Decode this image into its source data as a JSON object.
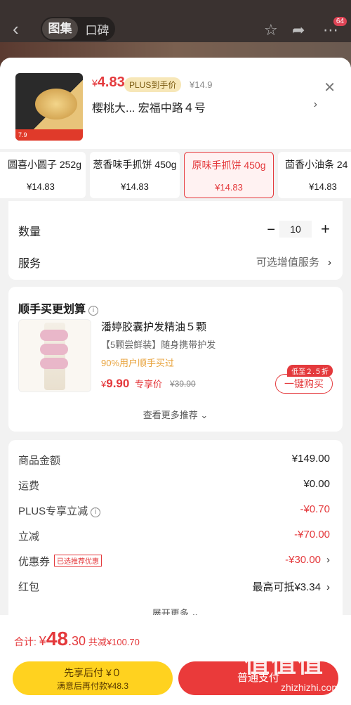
{
  "topbar": {
    "seg_tabs": [
      "图集",
      "口碑"
    ],
    "badge": "64"
  },
  "product": {
    "price_symbol": "¥",
    "price": "4.83",
    "plus_tag": "PLUS到手价",
    "orig_price": "¥14.9",
    "address": "樱桃大...  宏福中路４号",
    "thumb_tag": "7.9"
  },
  "variants": [
    {
      "name": "圆喜小圆子 252g",
      "price": "¥14.83"
    },
    {
      "name": "葱香味手抓饼 450g",
      "price": "¥14.83"
    },
    {
      "name": "原味手抓饼 450g",
      "price": "¥14.83"
    },
    {
      "name": "茴香小油条 24",
      "price": "¥14.83"
    }
  ],
  "quantity": {
    "label": "数量",
    "value": "10",
    "minus": "−",
    "plus": "+"
  },
  "service": {
    "label": "服务",
    "value": "可选增值服务"
  },
  "upsell": {
    "title": "顺手买更划算",
    "name": "潘婷胶囊护发精油５颗",
    "sub": "【5颗尝鲜装】随身携带护发",
    "pct": "90%用户顺手买过",
    "price_symbol": "¥",
    "price": "9.90",
    "price_label": "专享价",
    "old_price": "¥39.90",
    "discount": "低至２.５折",
    "buy": "一键购买",
    "more": "查看更多推荐"
  },
  "summary": {
    "rows": [
      {
        "label": "商品金额",
        "value": "¥149.00"
      },
      {
        "label": "运费",
        "value": "¥0.00"
      },
      {
        "label": "PLUS专享立减",
        "value": "-¥0.70"
      },
      {
        "label": "立减",
        "value": "-¥70.00"
      },
      {
        "label": "优惠券",
        "value": "-¥30.00",
        "tag": "已选推荐优惠"
      },
      {
        "label": "红包",
        "value": "最高可抵¥3.34"
      }
    ],
    "more": "展开更多"
  },
  "footer": {
    "total_label": "合计:",
    "total_symbol": "¥",
    "total_int": "48",
    "total_dec": ".30",
    "saved": "共减¥100.70",
    "later_t1": "先享后付 ¥０",
    "later_t2": "满意后再付款¥48.3",
    "pay": "普通支付"
  },
  "watermark": {
    "big": "值值值",
    "small": "zhizhizhi.com"
  },
  "colors": {
    "accent": "#e4393c",
    "plus": "#f7e7b8",
    "later": "#ffd21f"
  }
}
